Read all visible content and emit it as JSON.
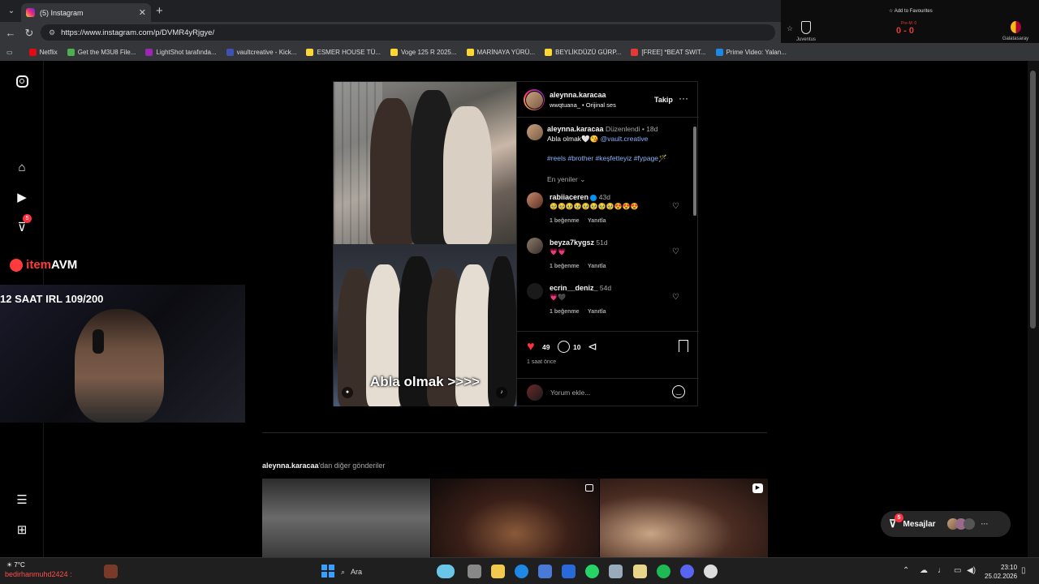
{
  "browser": {
    "tab_title": "(5) Instagram",
    "url": "https://www.instagram.com/p/DVMR4yRjgye/",
    "bookmarks": [
      {
        "label": "Netflix",
        "color": "#e50914"
      },
      {
        "label": "Get the M3U8 File...",
        "color": "#4caf50"
      },
      {
        "label": "LightShot tarafında...",
        "color": "#9c27b0"
      },
      {
        "label": "vaultcreative - Kick...",
        "color": "#3f51b5"
      },
      {
        "label": "ESMER HOUSE TÜ...",
        "color": "#fdd835"
      },
      {
        "label": "Voge 125 R 2025...",
        "color": "#fdd835"
      },
      {
        "label": "MARİNAYA YÜRÜ...",
        "color": "#fdd835"
      },
      {
        "label": "BEYLİKDÜZÜ GÜRP...",
        "color": "#fdd835"
      },
      {
        "label": "[FREE] *BEAT SWIT...",
        "color": "#e53935"
      },
      {
        "label": "Prime Video: Yalan...",
        "color": "#1e88e5"
      }
    ]
  },
  "score_widget": {
    "fav_label": "Add to Favourites",
    "team_home": "Juventus",
    "team_away": "Galatasaray",
    "score": "0 - 0",
    "status": "Pre-M: 0"
  },
  "sidebar": {
    "notifications_badge": "5"
  },
  "post": {
    "author": "aleynna.karacaa",
    "audio": "wwqtuana_ • Orijinal ses",
    "follow_label": "Takip",
    "caption_user": "aleynna.karacaa",
    "edited_label": "Düzenlendi",
    "caption_time": "18d",
    "caption_text": "Abla olmak🤍😘",
    "caption_mention": "@vault.creative",
    "hashtags": "#reels #brother #keşfetteyiz #fypage🪄",
    "sort_label": "En yeniler",
    "overlay_text": "Abla olmak >>>>",
    "comments": [
      {
        "user": "rabiiaceren",
        "verified": true,
        "time": "43d",
        "text": "🥹🥹🥹🥹🥹🥹🥹🥹😍😍😍",
        "likes": "1 beğenme",
        "reply": "Yanıtla"
      },
      {
        "user": "beyza7kygsz",
        "verified": false,
        "time": "51d",
        "text": "💗💗",
        "likes": "1 beğenme",
        "reply": "Yanıtla"
      },
      {
        "user": "ecrin__deniz_",
        "verified": false,
        "time": "54d",
        "text": "💗🖤",
        "likes": "1 beğenme",
        "reply": "Yanıtla"
      }
    ],
    "like_count": "49",
    "comment_count": "10",
    "posted_ago": "1 saat önce",
    "comment_placeholder": "Yorum ekle..."
  },
  "stream": {
    "title": "12 SAAT IRL 109/200",
    "logo_prefix": "item",
    "logo_suffix": "AVM",
    "chat_overlay": "bedirhanmuhd2424 :"
  },
  "more_posts": {
    "author": "aleynna.karacaa",
    "suffix": "'dan diğer gönderiler"
  },
  "messages": {
    "label": "Mesajlar",
    "badge": "5"
  },
  "taskbar": {
    "weather": "7°C",
    "search": "Ara",
    "time": "23:10",
    "date": "25.02.2026"
  }
}
